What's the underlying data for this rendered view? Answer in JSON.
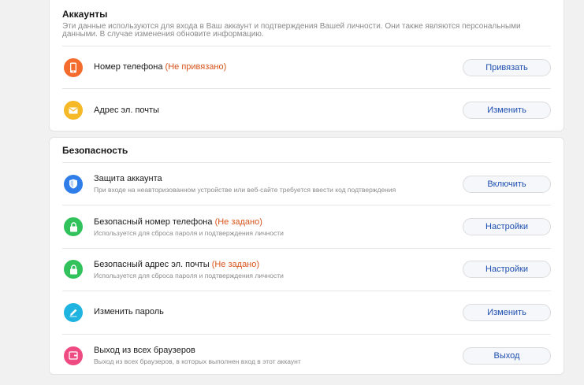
{
  "colors": {
    "phone_icon_bg": "#f36c2e",
    "mail_icon_bg": "#f5b827",
    "shield_icon_bg": "#2f7de8",
    "lock_icon_bg": "#31c25c",
    "pen_icon_bg": "#1fb3e0",
    "exit_icon_bg": "#ef4b83",
    "status_text": "#d8541c",
    "button_text": "#1f4fb0"
  },
  "accounts": {
    "title": "Аккаунты",
    "description": "Эти данные используются для входа в Ваш аккаунт и подтверждения Вашей личности. Они также являются персональными данными. В случае изменения обновите информацию.",
    "rows": [
      {
        "icon": "phone-icon",
        "title": "Номер телефона",
        "status": "(Не привязано)",
        "button": "Привязать"
      },
      {
        "icon": "mail-icon",
        "title": "Адрес эл. почты",
        "status": "",
        "button": "Изменить"
      }
    ]
  },
  "security": {
    "title": "Безопасность",
    "rows": [
      {
        "icon": "shield-icon",
        "title": "Защита аккаунта",
        "status": "",
        "subtitle": "При входе на неавторизованном устройстве или веб-сайте требуется ввести код подтверждения",
        "button": "Включить"
      },
      {
        "icon": "lock-icon",
        "title": "Безопасный номер телефона",
        "status": "(Не задано)",
        "subtitle": "Используется для сброса пароля и подтверждения личности",
        "button": "Настройки"
      },
      {
        "icon": "lock-icon",
        "title": "Безопасный адрес эл. почты",
        "status": "(Не задано)",
        "subtitle": "Используется для сброса пароля и подтверждения личности",
        "button": "Настройки"
      },
      {
        "icon": "pen-icon",
        "title": "Изменить пароль",
        "status": "",
        "subtitle": "",
        "button": "Изменить"
      },
      {
        "icon": "exit-icon",
        "title": "Выход из всех браузеров",
        "status": "",
        "subtitle": "Выход из всех браузеров, в которых выполнен вход в этот аккаунт",
        "button": "Выход"
      }
    ]
  }
}
